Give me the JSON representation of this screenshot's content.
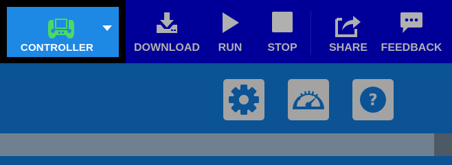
{
  "mode_selector": {
    "label": "CONTROLLER",
    "icon": "gamepad-icon",
    "accent": "#4cd964",
    "background": "#1e88e5"
  },
  "toolbar": {
    "background": "#000099",
    "label_color": "#b0b0b0",
    "buttons": [
      {
        "label": "DOWNLOAD",
        "icon": "download-icon"
      },
      {
        "label": "RUN",
        "icon": "play-icon"
      },
      {
        "label": "STOP",
        "icon": "stop-icon"
      },
      {
        "label": "SHARE",
        "icon": "share-icon"
      },
      {
        "label": "FEEDBACK",
        "icon": "feedback-icon"
      }
    ]
  },
  "actions": [
    {
      "icon": "gear-icon"
    },
    {
      "icon": "dashboard-icon"
    },
    {
      "icon": "help-icon"
    }
  ]
}
